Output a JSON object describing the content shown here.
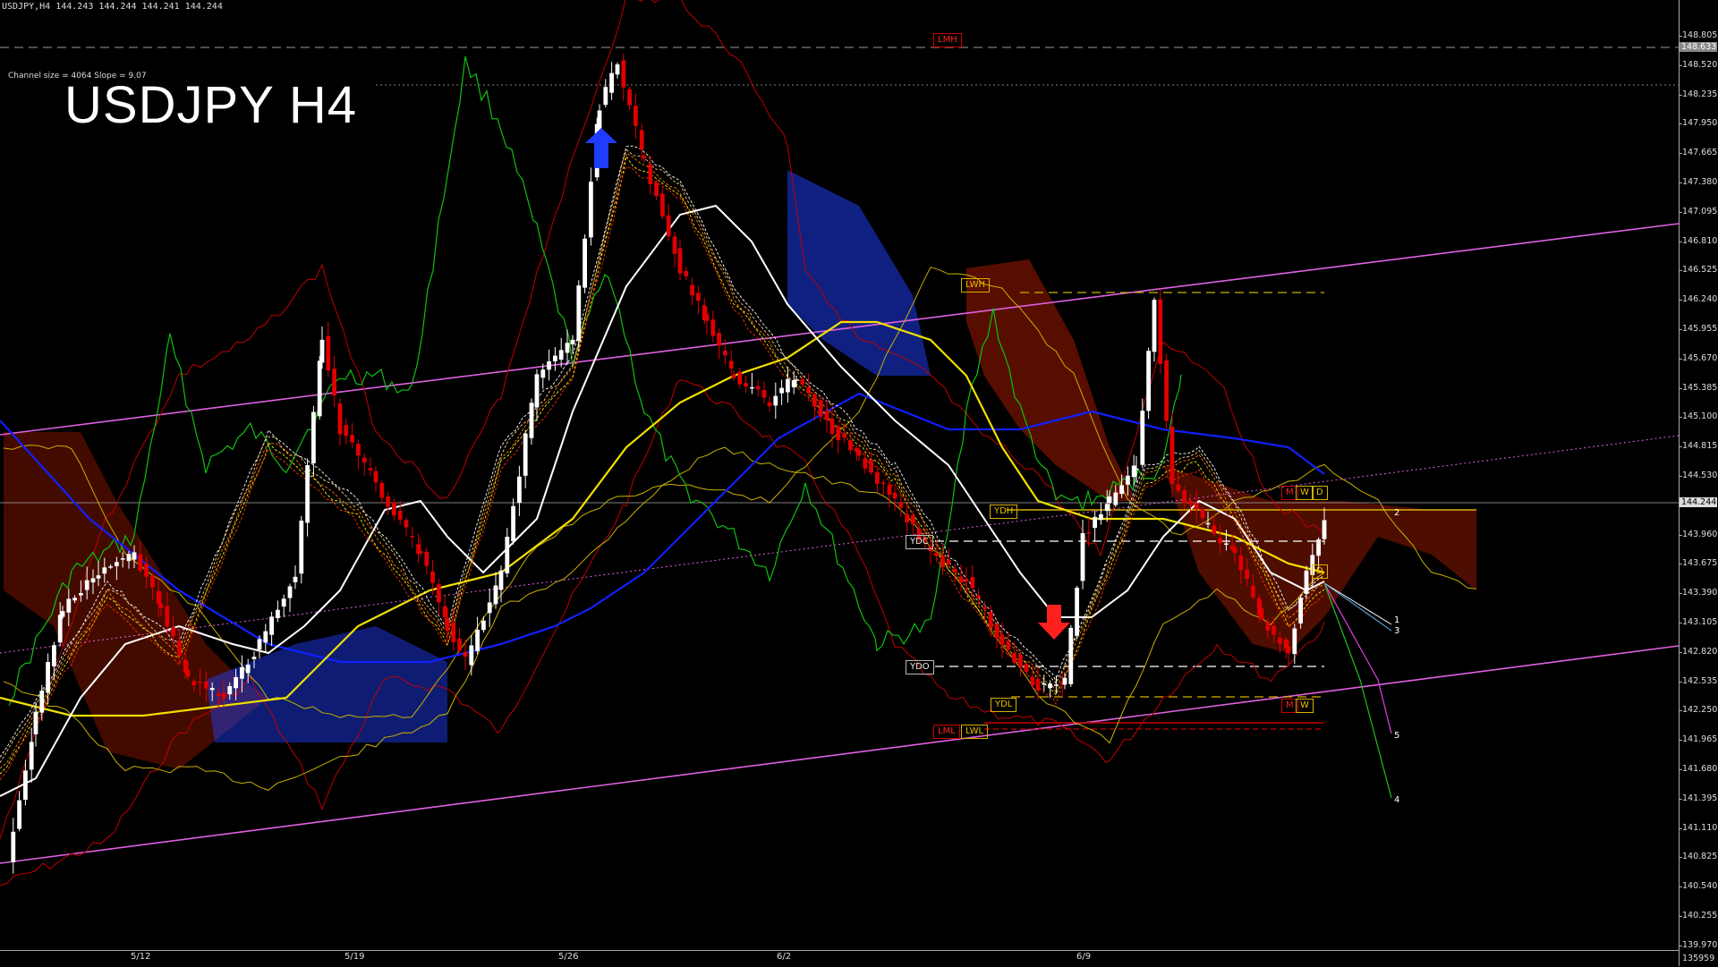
{
  "window": {
    "header": "USDJPY,H4  144.243 144.244 144.241 144.244",
    "channel_info": "Channel size = 4064 Slope = 9.07",
    "big_title": "USDJPY H4"
  },
  "price_axis": {
    "ticks": [
      "148.805",
      "148.520",
      "148.235",
      "147.950",
      "147.665",
      "147.380",
      "147.095",
      "146.810",
      "146.525",
      "146.240",
      "145.955",
      "145.670",
      "145.385",
      "145.100",
      "144.815",
      "144.530",
      "144.244",
      "143.960",
      "143.675",
      "143.390",
      "143.105",
      "142.820",
      "142.535",
      "142.250",
      "141.965",
      "141.680",
      "141.395",
      "141.110",
      "140.825",
      "140.540",
      "140.255",
      "139.970"
    ],
    "current_price": "144.244",
    "line_price": "148.633",
    "bottom_label": "135959"
  },
  "date_labels": [
    "5/12",
    "5/19",
    "5/26",
    "6/2",
    "6/9"
  ],
  "level_labels": {
    "lmh": "LMH",
    "lwh": "LWH",
    "ydh": "YDH",
    "ydc": "YDC",
    "ydo": "YDO",
    "ydl": "YDL",
    "lml": "LML",
    "lwl": "LWL",
    "m_top": "M",
    "w_top": "W",
    "d_top": "D",
    "d_mid": "D",
    "m_bot": "M",
    "w_bot": "W"
  },
  "projection_labels": [
    "2",
    "1",
    "3",
    "5",
    "4"
  ],
  "colors": {
    "bull": "#ffffff",
    "bear": "#e00000",
    "channel": "#e060e0",
    "tenkan": "#ffffff",
    "ma_yellow": "#f0e000",
    "ma_blue": "#1020ff",
    "chikou": "#10c010",
    "bands": "#c00000",
    "cloud_red": "#c02000",
    "cloud_blue": "#2040ff",
    "envelope": "#c8b000"
  },
  "chart_data": {
    "type": "candlestick",
    "symbol": "USDJPY",
    "timeframe": "H4",
    "ylim": [
      139.85,
      149.0
    ],
    "last_price": 144.244,
    "channel": {
      "slope": 9.07,
      "size": 4064
    }
  }
}
